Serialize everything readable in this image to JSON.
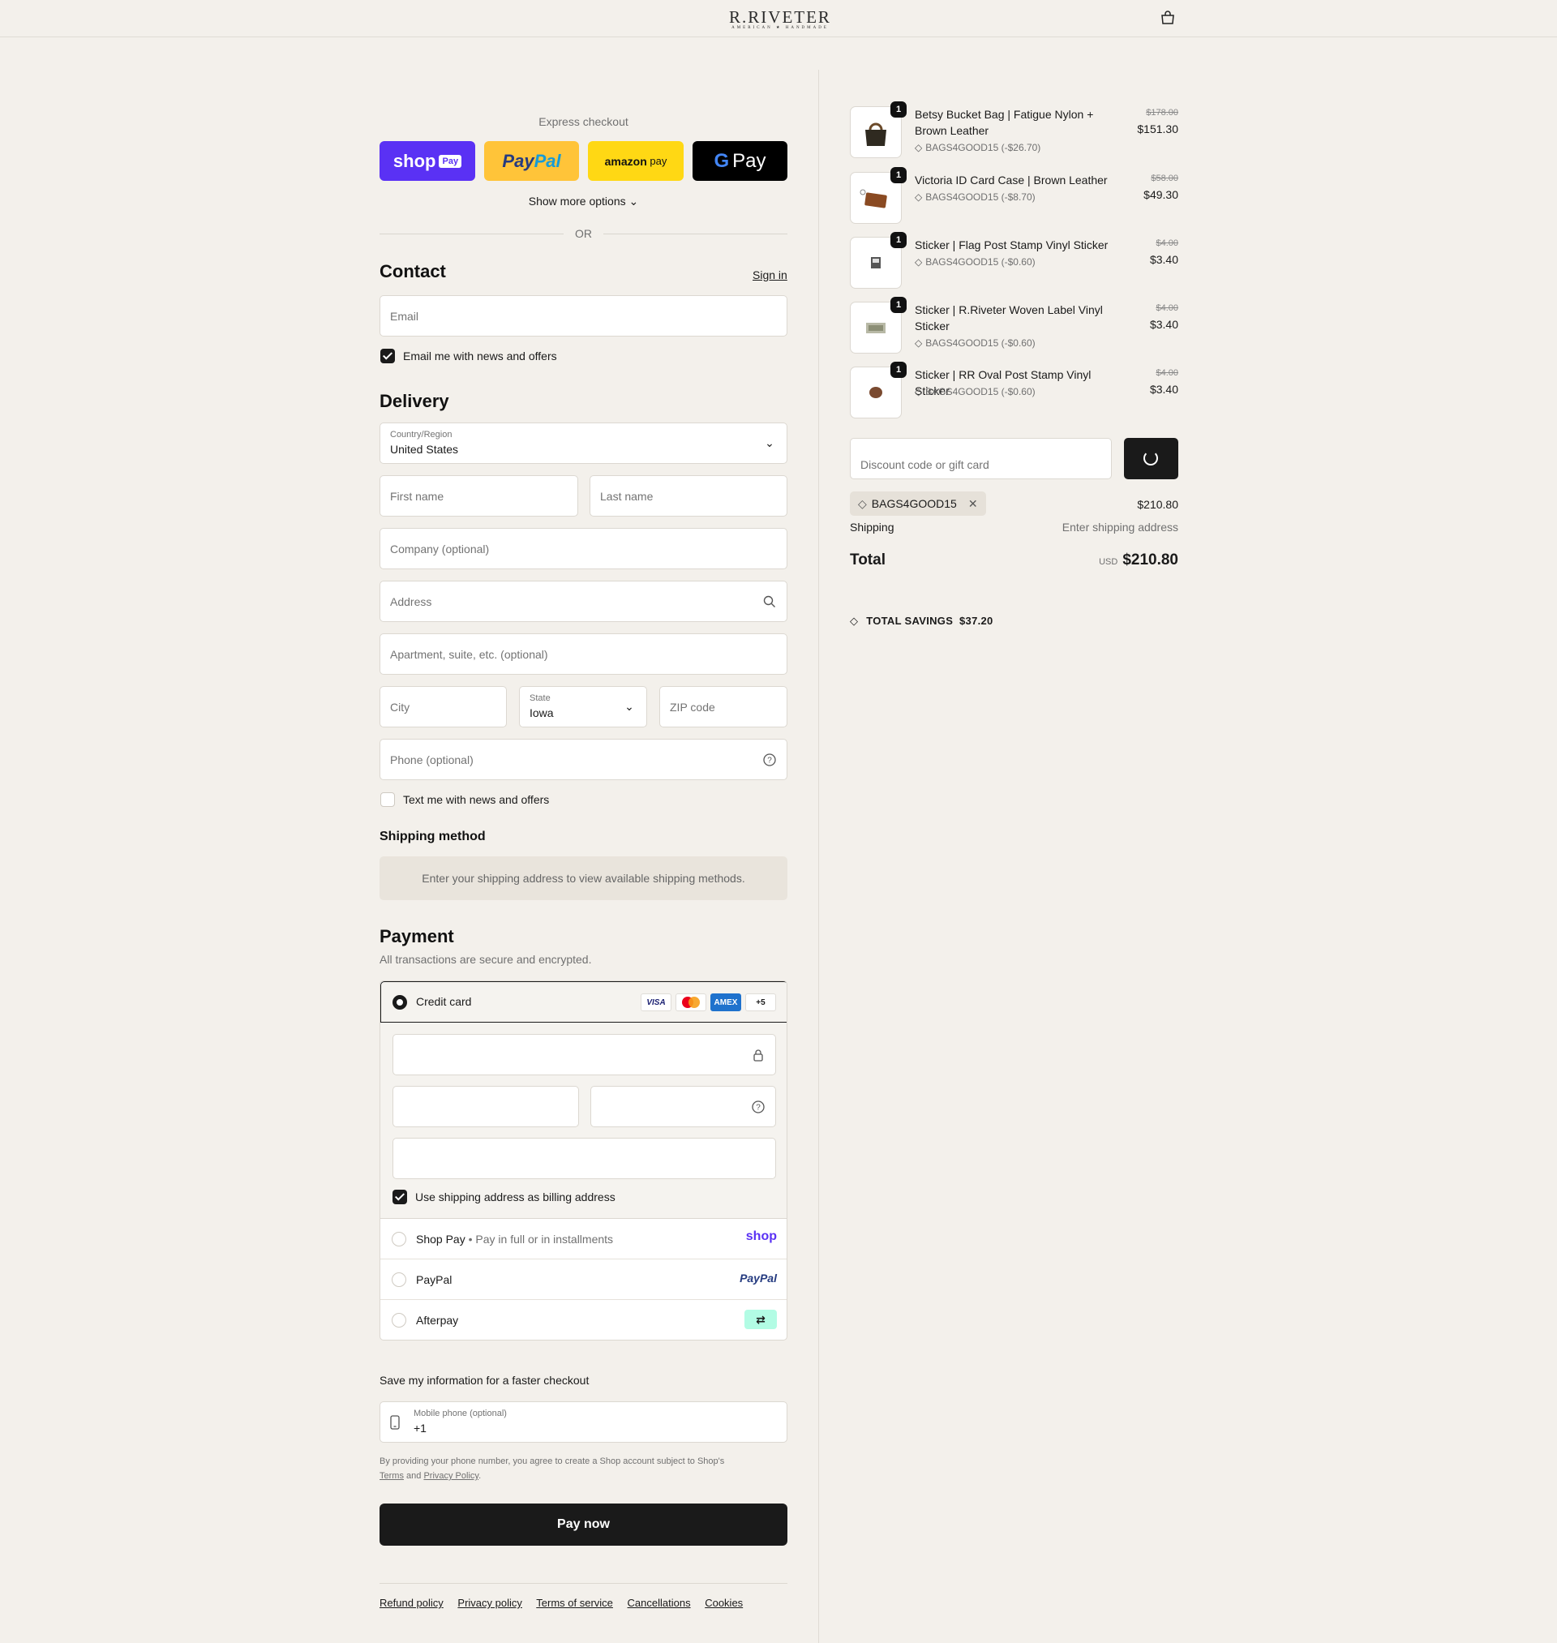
{
  "header": {
    "logo_main": "R.RIVETER",
    "logo_sub": "AMERICAN ★ HANDMADE",
    "cart_icon": "bag-icon"
  },
  "express": {
    "label": "Express checkout",
    "shop_pay": "shop",
    "shop_pay_tag": "Pay",
    "paypal_1": "Pay",
    "paypal_2": "Pal",
    "amazon_1": "amazon",
    "amazon_2": "pay",
    "gpay_g": "G",
    "gpay": "Pay",
    "show_more": "Show more options",
    "or": "OR"
  },
  "contact": {
    "title": "Contact",
    "sign_in": "Sign in",
    "email_placeholder": "Email",
    "news_label": "Email me with news and offers",
    "news_checked": true
  },
  "delivery": {
    "title": "Delivery",
    "country_label": "Country/Region",
    "country_value": "United States",
    "first_name": "First name",
    "last_name": "Last name",
    "company": "Company (optional)",
    "address": "Address",
    "apartment": "Apartment, suite, etc. (optional)",
    "city": "City",
    "state_label": "State",
    "state_value": "Iowa",
    "zip": "ZIP code",
    "phone": "Phone (optional)",
    "text_label": "Text me with news and offers",
    "text_checked": false
  },
  "shipping_method": {
    "title": "Shipping method",
    "message": "Enter your shipping address to view available shipping methods."
  },
  "payment": {
    "title": "Payment",
    "subtitle": "All transactions are secure and encrypted.",
    "credit_card": "Credit card",
    "brands": [
      "VISA",
      "MC",
      "AMEX",
      "+5"
    ],
    "billing_label": "Use shipping address as billing address",
    "shop_pay_label": "Shop Pay",
    "shop_pay_sub": "Pay in full or in installments",
    "shop_logo": "shop",
    "paypal_label": "PayPal",
    "paypal_logo": "PayPal",
    "afterpay_label": "Afterpay"
  },
  "save_info": {
    "title": "Save my information for a faster checkout",
    "mobile_label": "Mobile phone (optional)",
    "mobile_value": "+1",
    "fine_1": "By providing your phone number, you agree to create a Shop account subject to Shop's",
    "terms": "Terms",
    "and": "and",
    "privacy": "Privacy Policy"
  },
  "pay_now": "Pay now",
  "footer": [
    "Refund policy",
    "Privacy policy",
    "Terms of service",
    "Cancellations",
    "Cookies"
  ],
  "cart": {
    "items": [
      {
        "qty": "1",
        "name": "Betsy Bucket Bag | Fatigue Nylon + Brown Leather",
        "discount": "BAGS4GOOD15 (-$26.70)",
        "old_price": "$178.00",
        "price": "$151.30"
      },
      {
        "qty": "1",
        "name": "Victoria ID Card Case | Brown Leather",
        "discount": "BAGS4GOOD15 (-$8.70)",
        "old_price": "$58.00",
        "price": "$49.30"
      },
      {
        "qty": "1",
        "name": "Sticker | Flag Post Stamp Vinyl Sticker",
        "discount": "BAGS4GOOD15 (-$0.60)",
        "old_price": "$4.00",
        "price": "$3.40"
      },
      {
        "qty": "1",
        "name": "Sticker | R.Riveter Woven Label Vinyl Sticker",
        "discount": "BAGS4GOOD15 (-$0.60)",
        "old_price": "$4.00",
        "price": "$3.40"
      },
      {
        "qty": "1",
        "name": "Sticker | RR Oval Post Stamp Vinyl Sticker",
        "discount": "BAGS4GOOD15 (-$0.60)",
        "old_price": "$4.00",
        "price": "$3.40"
      }
    ],
    "discount_placeholder": "Discount code or gift card",
    "applied_code": "BAGS4GOOD15",
    "subtotal": "$210.80",
    "shipping_label": "Shipping",
    "shipping_value": "Enter shipping address",
    "total_label": "Total",
    "currency": "USD",
    "total": "$210.80",
    "savings_label": "TOTAL SAVINGS",
    "savings_value": "$37.20"
  }
}
